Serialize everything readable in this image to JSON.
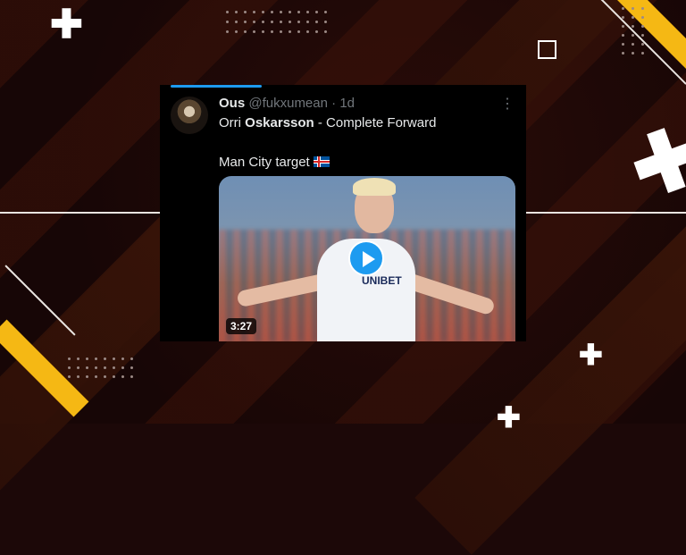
{
  "tweet": {
    "display_name": "Ous",
    "handle": "@fukxumean",
    "separator": "·",
    "time": "1d",
    "more_icon": "more-horizontal-icon",
    "line1_prefix": "Orri ",
    "line1_bold": "Oskarsson",
    "line1_suffix": " - Complete Forward",
    "line2": "Man City target",
    "flag_icon": "iceland-flag-icon",
    "video": {
      "duration": "3:27",
      "sponsor": "UNIBET",
      "play_icon": "play-icon"
    }
  },
  "colors": {
    "accent": "#1d9bf0",
    "background": "#1c0808",
    "highlight": "#f5b814"
  }
}
